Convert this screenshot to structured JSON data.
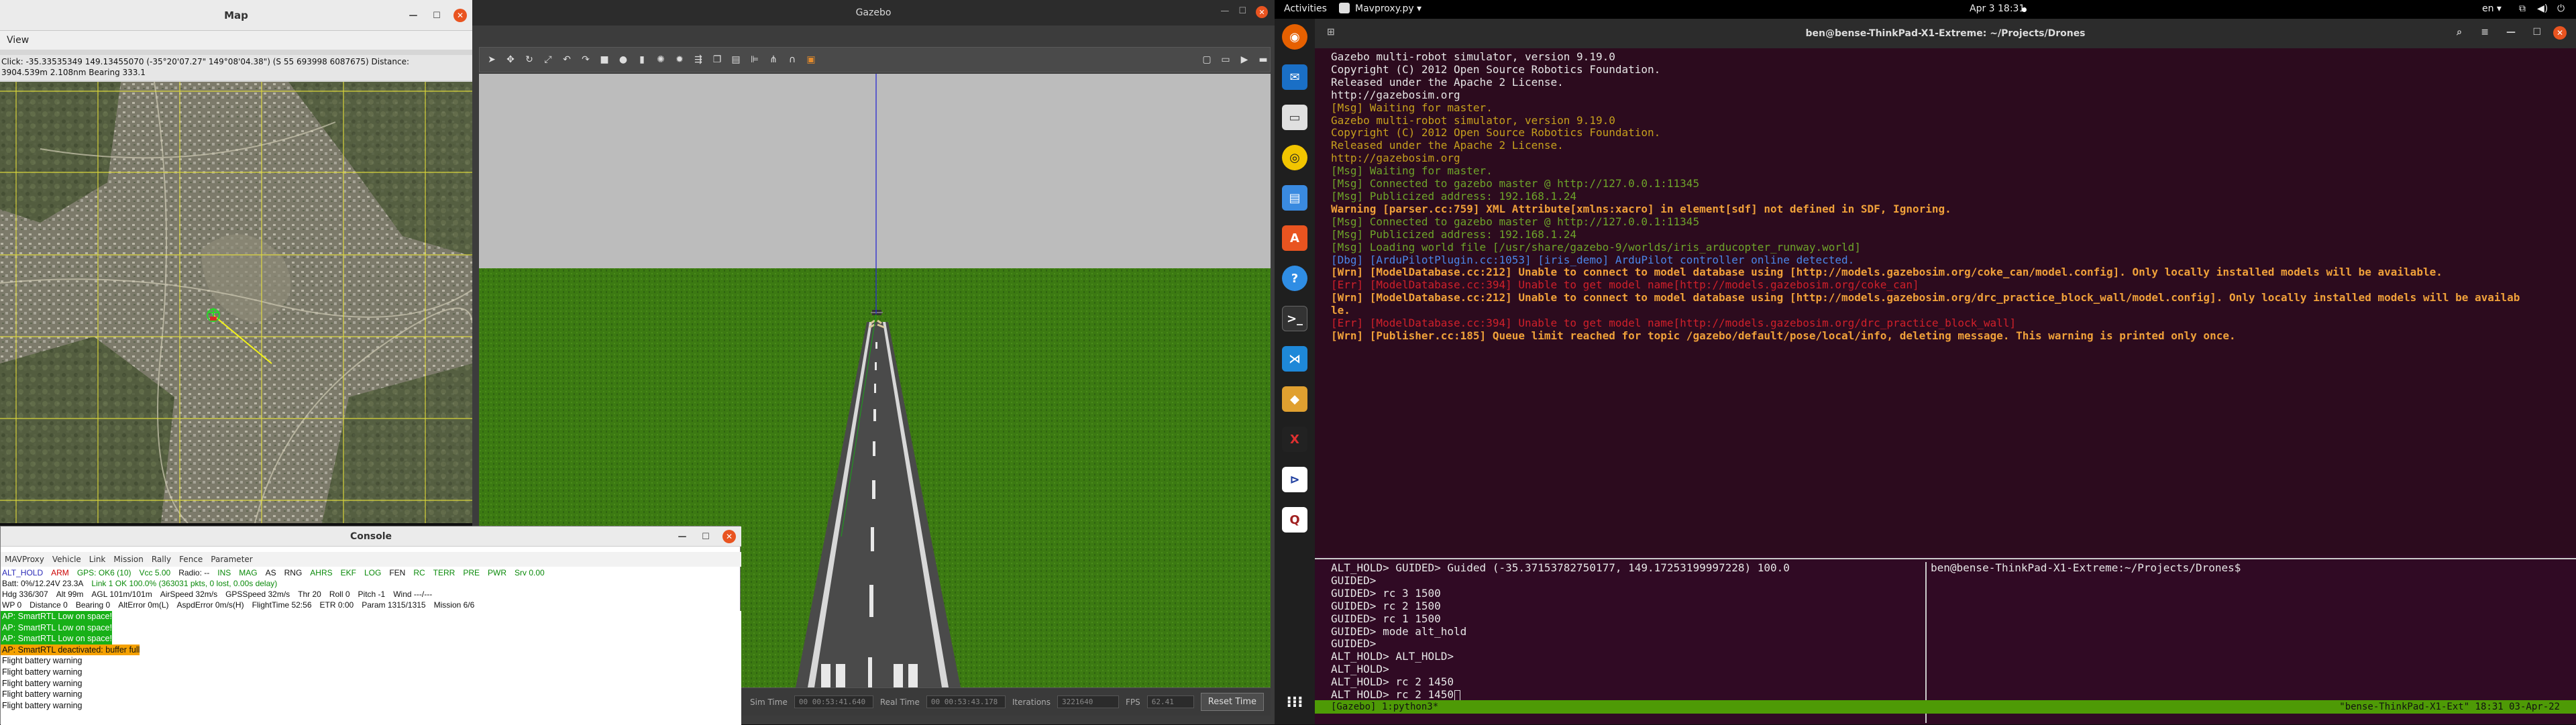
{
  "map": {
    "title": "Map",
    "menu_view": "View",
    "info_line1": "Click: -35.33535349 149.13455070 (-35°20'07.27\" 149°08'04.38\") (S 55 693998 6087675)  Distance:",
    "info_line2": "3904.539m 2.108nm Bearing 333.1"
  },
  "gazebo": {
    "title": "Gazebo",
    "sim_time_label": "Sim Time",
    "sim_time": "00 00:53:41.640",
    "real_time_label": "Real Time",
    "real_time": "00 00:53:43.178",
    "iterations_label": "Iterations",
    "iterations": "3221640",
    "fps_label": "FPS",
    "fps": "62.41",
    "reset_label": "Reset Time"
  },
  "console": {
    "title": "Console",
    "menu": [
      "MAVProxy",
      "Vehicle",
      "Link",
      "Mission",
      "Rally",
      "Fence",
      "Parameter"
    ],
    "row1": [
      {
        "t": "ALT_HOLD",
        "c": "b"
      },
      {
        "t": "ARM",
        "c": "r"
      },
      {
        "t": "GPS: OK6 (10)",
        "c": "g"
      },
      {
        "t": "Vcc 5.00",
        "c": "g"
      },
      {
        "t": "Radio: --",
        "c": "k"
      },
      {
        "t": "INS",
        "c": "g"
      },
      {
        "t": "MAG",
        "c": "g"
      },
      {
        "t": "AS",
        "c": "k"
      },
      {
        "t": "RNG",
        "c": "k"
      },
      {
        "t": "AHRS",
        "c": "g"
      },
      {
        "t": "EKF",
        "c": "g"
      },
      {
        "t": "LOG",
        "c": "g"
      },
      {
        "t": "FEN",
        "c": "k"
      },
      {
        "t": "RC",
        "c": "g"
      },
      {
        "t": "TERR",
        "c": "g"
      },
      {
        "t": "PRE",
        "c": "g"
      },
      {
        "t": "PWR",
        "c": "g"
      },
      {
        "t": "Srv 0.00",
        "c": "g"
      }
    ],
    "row2": [
      {
        "t": "Batt: 0%/12.24V 23.3A",
        "c": "k"
      },
      {
        "t": "Link 1 OK 100.0% (363031 pkts, 0 lost, 0.00s delay)",
        "c": "g"
      }
    ],
    "row3": [
      "Hdg 336/307",
      "Alt 99m",
      "AGL 101m/101m",
      "AirSpeed 32m/s",
      "GPSSpeed 32m/s",
      "Thr 20",
      "Roll 0",
      "Pitch -1",
      "Wind ---/---"
    ],
    "row4": [
      "WP 0",
      "Distance 0",
      "Bearing 0",
      "AltError 0m(L)",
      "AspdError 0m/s(H)",
      "FlightTime 52:56",
      "ETR 0:00",
      "Param 1315/1315",
      "Mission 6/6"
    ],
    "log": [
      {
        "t": "AP: SmartRTL Low on space!",
        "bg": "#18b018",
        "fg": "#ffffff"
      },
      {
        "t": "AP: SmartRTL Low on space!",
        "bg": "#18b018",
        "fg": "#ffffff"
      },
      {
        "t": "AP: SmartRTL Low on space!",
        "bg": "#18b018",
        "fg": "#ffffff"
      },
      {
        "t": "AP: SmartRTL deactivated: buffer full",
        "bg": "#f5a100",
        "fg": "#111111"
      },
      {
        "t": "Flight battery warning",
        "bg": "#ffffff",
        "fg": "#111111"
      },
      {
        "t": "Flight battery warning",
        "bg": "#ffffff",
        "fg": "#111111"
      },
      {
        "t": "Flight battery warning",
        "bg": "#ffffff",
        "fg": "#111111"
      },
      {
        "t": "Flight battery warning",
        "bg": "#ffffff",
        "fg": "#111111"
      },
      {
        "t": "Flight battery warning",
        "bg": "#ffffff",
        "fg": "#111111"
      }
    ]
  },
  "ubuntu": {
    "activities": "Activities",
    "app_menu": "Mavproxy.py ▾",
    "clock": "Apr 3  18:31",
    "lang": "en ▾"
  },
  "terminal": {
    "title": "ben@bense-ThinkPad-X1-Extreme: ~/Projects/Drones",
    "top_lines": [
      {
        "t": "Gazebo multi-robot simulator, version 9.19.0",
        "c": "c-w"
      },
      {
        "t": "Copyright (C) 2012 Open Source Robotics Foundation.",
        "c": "c-w"
      },
      {
        "t": "Released under the Apache 2 License.",
        "c": "c-w"
      },
      {
        "t": "http://gazebosim.org",
        "c": "c-w"
      },
      {
        "t": "",
        "c": "c-w"
      },
      {
        "t": "[Msg] Waiting for master.",
        "c": "c-y"
      },
      {
        "t": "Gazebo multi-robot simulator, version 9.19.0",
        "c": "c-y"
      },
      {
        "t": "Copyright (C) 2012 Open Source Robotics Foundation.",
        "c": "c-y"
      },
      {
        "t": "Released under the Apache 2 License.",
        "c": "c-y"
      },
      {
        "t": "http://gazebosim.org",
        "c": "c-y"
      },
      {
        "t": "",
        "c": "c-w"
      },
      {
        "t": "[Msg] Waiting for master.",
        "c": "c-g"
      },
      {
        "t": "[Msg] Connected to gazebo master @ http://127.0.0.1:11345",
        "c": "c-g"
      },
      {
        "t": "[Msg] Publicized address: 192.168.1.24",
        "c": "c-g"
      },
      {
        "t": "Warning [parser.cc:759] XML Attribute[xmlns:xacro] in element[sdf] not defined in SDF, Ignoring.",
        "c": "c-o"
      },
      {
        "t": "[Msg] Connected to gazebo master @ http://127.0.0.1:11345",
        "c": "c-g"
      },
      {
        "t": "[Msg] Publicized address: 192.168.1.24",
        "c": "c-g"
      },
      {
        "t": "[Msg] Loading world file [/usr/share/gazebo-9/worlds/iris_arducopter_runway.world]",
        "c": "c-g"
      },
      {
        "t": "[Dbg] [ArduPilotPlugin.cc:1053] [iris_demo] ArduPilot controller online detected.",
        "c": "c-b"
      },
      {
        "t": "[Wrn] [ModelDatabase.cc:212] Unable to connect to model database using [http://models.gazebosim.org/coke_can/model.config]. Only locally installed models will be available.",
        "c": "c-o"
      },
      {
        "t": "[Err] [ModelDatabase.cc:394] Unable to get model name[http://models.gazebosim.org/coke_can]",
        "c": "c-r"
      },
      {
        "t": "[Wrn] [ModelDatabase.cc:212] Unable to connect to model database using [http://models.gazebosim.org/drc_practice_block_wall/model.config]. Only locally installed models will be availab",
        "c": "c-o"
      },
      {
        "t": "le.",
        "c": "c-o"
      },
      {
        "t": "[Err] [ModelDatabase.cc:394] Unable to get model name[http://models.gazebosim.org/drc_practice_block_wall]",
        "c": "c-r"
      },
      {
        "t": "[Wrn] [Publisher.cc:185] Queue limit reached for topic /gazebo/default/pose/local/info, deleting message. This warning is printed only once.",
        "c": "c-o"
      }
    ],
    "left_pane": [
      "ALT_HOLD> GUIDED> Guided (-35.37153782750177, 149.17253199997228) 100.0",
      "",
      "GUIDED>",
      "GUIDED> rc 3 1500",
      "GUIDED> rc 2 1500",
      "GUIDED> rc 1 1500",
      "GUIDED> mode alt_hold",
      "GUIDED>",
      "ALT_HOLD> ALT_HOLD>",
      "ALT_HOLD>",
      "ALT_HOLD> rc 2 1450",
      "ALT_HOLD> rc 2 1450"
    ],
    "right_pane": [
      "ben@bense-ThinkPad-X1-Extreme:~/Projects/Drones$"
    ],
    "tmux_left": "[Gazebo] 1:python3*",
    "tmux_right": "\"bense-ThinkPad-X1-Ext\" 18:31 03-Apr-22"
  }
}
